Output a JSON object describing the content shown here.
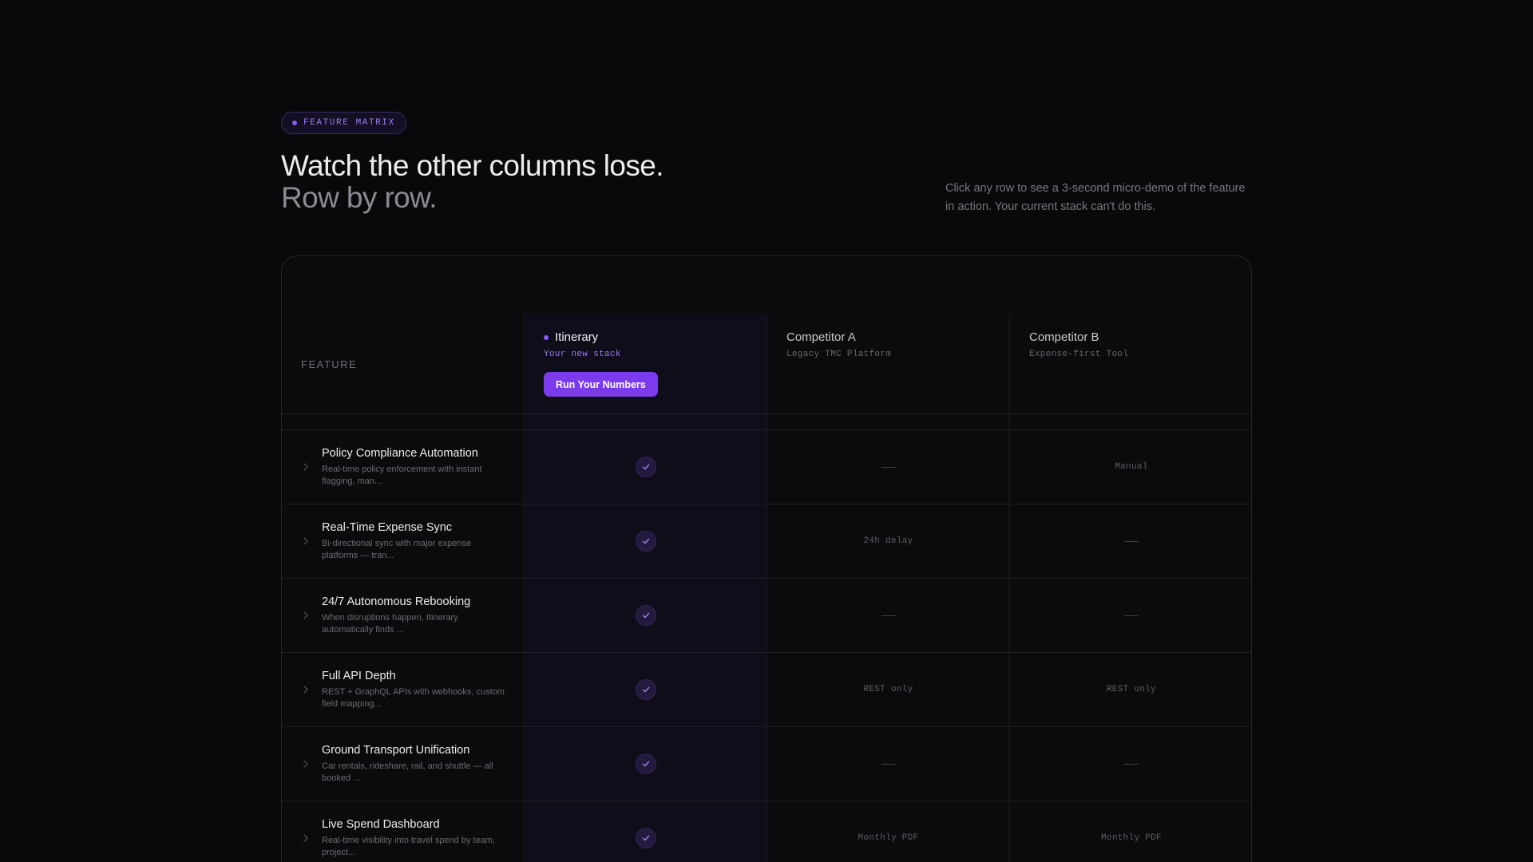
{
  "badge": {
    "label": "FEATURE MATRIX"
  },
  "headline": {
    "line1": "Watch the other columns lose.",
    "line2": "Row by row."
  },
  "intro": "Click any row to see a 3-second micro-demo of the feature in action. Your current stack can't do this.",
  "matrix": {
    "feature_header": "FEATURE",
    "columns": [
      {
        "name": "Itinerary",
        "subtitle": "Your new stack",
        "cta": "Run Your Numbers"
      },
      {
        "name": "Competitor A",
        "subtitle": "Legacy TMC Platform"
      },
      {
        "name": "Competitor B",
        "subtitle": "Expense-first Tool"
      }
    ],
    "rows": [
      {
        "title": "Policy Compliance Automation",
        "desc": "Real-time policy enforcement with instant flagging, man...",
        "itinerary": "check",
        "a": {
          "type": "dash",
          "text": ""
        },
        "b": {
          "type": "text",
          "text": "Manual"
        }
      },
      {
        "title": "Real-Time Expense Sync",
        "desc": "Bi-directional sync with major expense platforms — tran...",
        "itinerary": "check",
        "a": {
          "type": "text",
          "text": "24h delay"
        },
        "b": {
          "type": "dash",
          "text": ""
        }
      },
      {
        "title": "24/7 Autonomous Rebooking",
        "desc": "When disruptions happen, Itinerary automatically finds ...",
        "itinerary": "check",
        "a": {
          "type": "dash",
          "text": ""
        },
        "b": {
          "type": "dash",
          "text": ""
        }
      },
      {
        "title": "Full API Depth",
        "desc": "REST + GraphQL APIs with webhooks, custom field mapping...",
        "itinerary": "check",
        "a": {
          "type": "text",
          "text": "REST only"
        },
        "b": {
          "type": "text",
          "text": "REST only"
        }
      },
      {
        "title": "Ground Transport Unification",
        "desc": "Car rentals, rideshare, rail, and shuttle — all booked ...",
        "itinerary": "check",
        "a": {
          "type": "dash",
          "text": ""
        },
        "b": {
          "type": "dash",
          "text": ""
        }
      },
      {
        "title": "Live Spend Dashboard",
        "desc": "Real-time visibility into travel spend by team, project...",
        "itinerary": "check",
        "a": {
          "type": "text",
          "text": "Monthly PDF"
        },
        "b": {
          "type": "text",
          "text": "Monthly PDF"
        }
      }
    ]
  },
  "icons": {
    "check": "check-icon",
    "chevron": "chevron-right-icon",
    "dash": "dash-icon"
  },
  "colors": {
    "background": "#09090b",
    "accent": "#7c3aed",
    "accent_text": "#9f7cf2",
    "highlight_column": "#0f0d1a"
  }
}
